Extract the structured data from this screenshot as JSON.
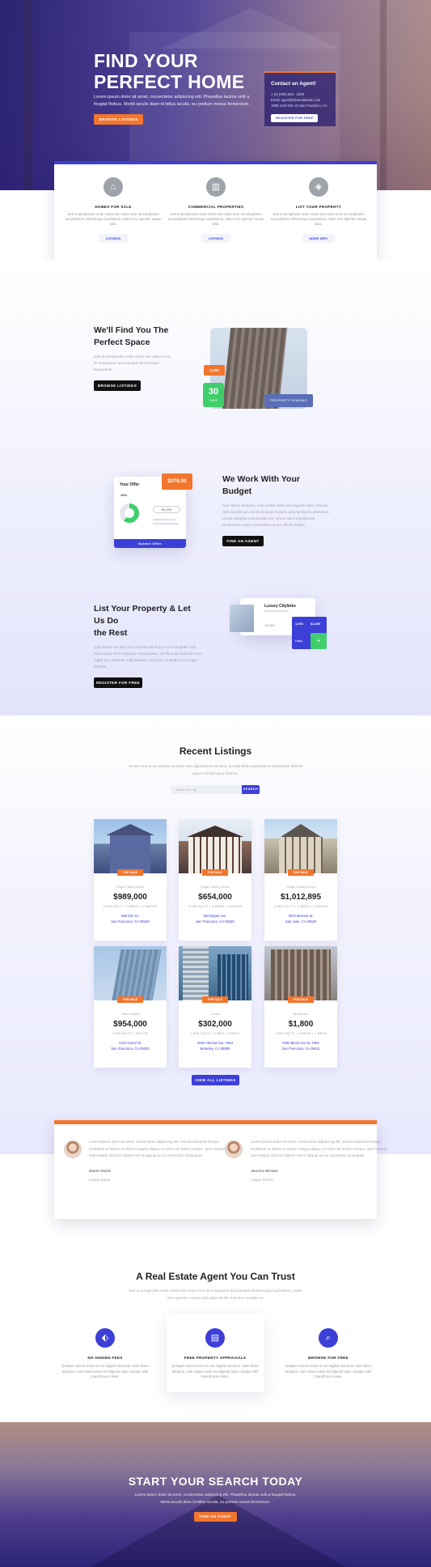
{
  "hero": {
    "title_line1": "FIND YOUR",
    "title_line2": "PERFECT HOME",
    "subtitle": "Lorem ipsum dolor sit amet, consectetur adipiscing elit. Phasellus lacinia velit a feugiat finibus. Morbi iaculis diam id tellus iaculis, eu pretium metus fermentum.",
    "button": "BROWSE LISTINGS",
    "contact": {
      "title": "Contact an Agent!",
      "phone": "1-(4) (000) 555 - 2039",
      "email": "Email: agent@divirealestate.com",
      "address": "1955 1040 Den St San Francisco, CA",
      "button": "REGISTER FOR FREE"
    }
  },
  "services": [
    {
      "icon": "house-icon",
      "title": "HOMES FOR SALE",
      "text": "Sed ut perspiciatis unde omnis iste natus error sit voluptatem accusantium doloremque laudantium, totam rem aperiam eaque ipsa.",
      "button": "LISTINGS"
    },
    {
      "icon": "building-icon",
      "title": "COMMERCIAL PROPERTIES",
      "text": "Sed ut perspiciatis unde omnis iste natus error sit voluptatem accusantium doloremque laudantium, totam rem aperiam eaque ipsa.",
      "button": "LISTINGS"
    },
    {
      "icon": "shield-icon",
      "title": "LIST YOUR PROPERTY",
      "text": "Sed ut perspiciatis unde omnis iste natus error sit voluptatem accusantium doloremque laudantium, totam rem aperiam eaque ipsa.",
      "button": "MORE INFO"
    }
  ],
  "features": [
    {
      "title_line1": "We'll Find You The",
      "title_line2": "Perfect Space",
      "text": "Sed ut perspiciatis unde omnis iste natus error sit voluptatem accusantium doloremque laudantium.",
      "button": "BROWSE LISTINGS"
    },
    {
      "title_line1": "We Work With Your Budget",
      "title_line2": "",
      "text": "Nam libero tempore, cum soluta nobis est eligendi optio cumque nihil impedit quo minus id quod maxime placeat facere possimus, omnis voluptas assumenda est, omnis dolor repellendus temporibus autem quibusdam et aut officiis debitis.",
      "button": "FIND AN AGENT"
    },
    {
      "title_line1": "List Your Property & Let Us Do",
      "title_line2": "the Rest",
      "text": "Quis autem vel eum iure reprehenderit qui in ea voluptate velit esse quam nihil molestiae consequatur, vel illum qui dolorem eum fugiat quo voluptas nulla pariatur sed quia consequuntur magni dolores.",
      "button": "REGISTER FOR FREE"
    }
  ],
  "feature_graphics": {
    "badge_value": "1,000",
    "days_value": "30",
    "days_label": "DAYS",
    "pending_label": "PROPERTY PENDING",
    "offer_title": "Your Offer",
    "offer_price": "$378.00",
    "offer_pct": "-40%",
    "offer_amount": "$1,000",
    "offer_button": "Submit Offer",
    "listing_name": "Luxury Citylinks",
    "listing_meta_1": "1,000",
    "listing_meta_2": "10,000",
    "listing_stat_1": "Days",
    "listing_stat_2": "+"
  },
  "listings": {
    "title": "Recent Listings",
    "subtitle": "At vero eos et accusamus et iusto odio dignissimos ducimus qui blanditiis praesentium voluptatum deleniti atque corrupti quos dolores.",
    "search_placeholder": "Search by City",
    "search_button": "SEARCH",
    "tag": "FOR SALE",
    "items": [
      {
        "type": "Single Family Home",
        "price": "$989,000",
        "specs": "2,500 SQ.FT  •  3 BEDS  •  2 BATHS",
        "addr1": "999 Elm Dr.",
        "addr2": "San Francisco, CA 09340"
      },
      {
        "type": "Single Family Home",
        "price": "$654,000",
        "specs": "2,000 SQ.FT  •  3 BEDS  •  2 BATHS",
        "addr1": "504 Elgant Ave.",
        "addr2": "San Francisco, CA 09340"
      },
      {
        "type": "Single Family Home",
        "price": "$1,012,895",
        "specs": "3,500 SQ.FT  •  4 BEDS  •  3 BATHS",
        "addr1": "3078 Morrant St.",
        "addr2": "San Jose, CA 09340"
      },
      {
        "type": "Office Space",
        "price": "$954,000",
        "specs": "2,000 SQ.FT  •  OFFICE",
        "addr1": "1224 Grand St.",
        "addr2": "San Francisco, CA 09320"
      },
      {
        "type": "Condo",
        "price": "$302,000",
        "specs": "1,000 SQ.FT  •  1 BED  •  1 BATH",
        "addr1": "0000 Almond Ave. #404",
        "addr2": "Berkeley, CA 09880"
      },
      {
        "type": "Apartment",
        "price": "$1,800",
        "specs": "1,000 SQ.FT  •  2 BEDS  •  1 BATH",
        "addr1": "0000 Block Ave St. #301",
        "addr2": "San Francisco, CA 09411"
      }
    ],
    "view_all": "VIEW ALL LISTINGS"
  },
  "testimonials": [
    {
      "text": "Lorem ipsum dolor sit amet, consectetur adipiscing elit, sed do eiusmod tempor incididunt ut labore et dolore magna aliqua. Ut enim ad minim veniam, quis nostrud exercitation ullamco laboris nisi ut aliquip ex ea commodo consequat.",
      "name": "Diane Davis",
      "company": "Happy Buyer"
    },
    {
      "text": "Lorem ipsum dolor sit amet, consectetur adipiscing elit, sed do eiusmod tempor incididunt ut labore et dolore magna aliqua. Ut enim ad minim veniam, quis nostrud exercitation ullamco laboris nisi ut aliquip ex ea commodo consequat.",
      "name": "Jessica Brown",
      "company": "Happy Renter"
    }
  ],
  "trust": {
    "title": "A Real Estate Agent You Can Trust",
    "subtitle": "Sed ut perspiciatis unde omnis iste natus error sit voluptatem accusantium doloremque laudantium, totam rem aperiam, eaque ipsa quae ab illo inventore veritatis et.",
    "items": [
      {
        "icon": "tag-icon",
        "title": "NO HIDDEN FEES",
        "text": "Quisque viverra lectus in nisi sagittis interdum. Nam libero tempore, cum soluta nobis est eligendi optio cumque nihil impedit quo minus."
      },
      {
        "icon": "document-icon",
        "title": "FREE PROPERTY APPRAISALS",
        "text": "Quisque viverra lectus in nisi sagittis interdum. Nam libero tempore, cum soluta nobis est eligendi optio cumque nihil impedit quo minus."
      },
      {
        "icon": "search-icon",
        "title": "BROWSE FOR FREE",
        "text": "Quisque viverra lectus in nisi sagittis interdum. Nam libero tempore, cum soluta nobis est eligendi optio cumque nihil impedit quo minus."
      }
    ]
  },
  "cta": {
    "title": "START YOUR SEARCH TODAY",
    "text": "Lorem ipsum dolor sit amet, consectetur adipiscing elit. Phasellus lacinia velit a feugiat finibus. Morbi iaculis diam id tellus iaculis, eu pretium metus fermentum.",
    "button": "FIND AN AGENT"
  },
  "colors": {
    "accent": "#3d40d6",
    "orange": "#f2762e",
    "green": "#3fce6b"
  }
}
